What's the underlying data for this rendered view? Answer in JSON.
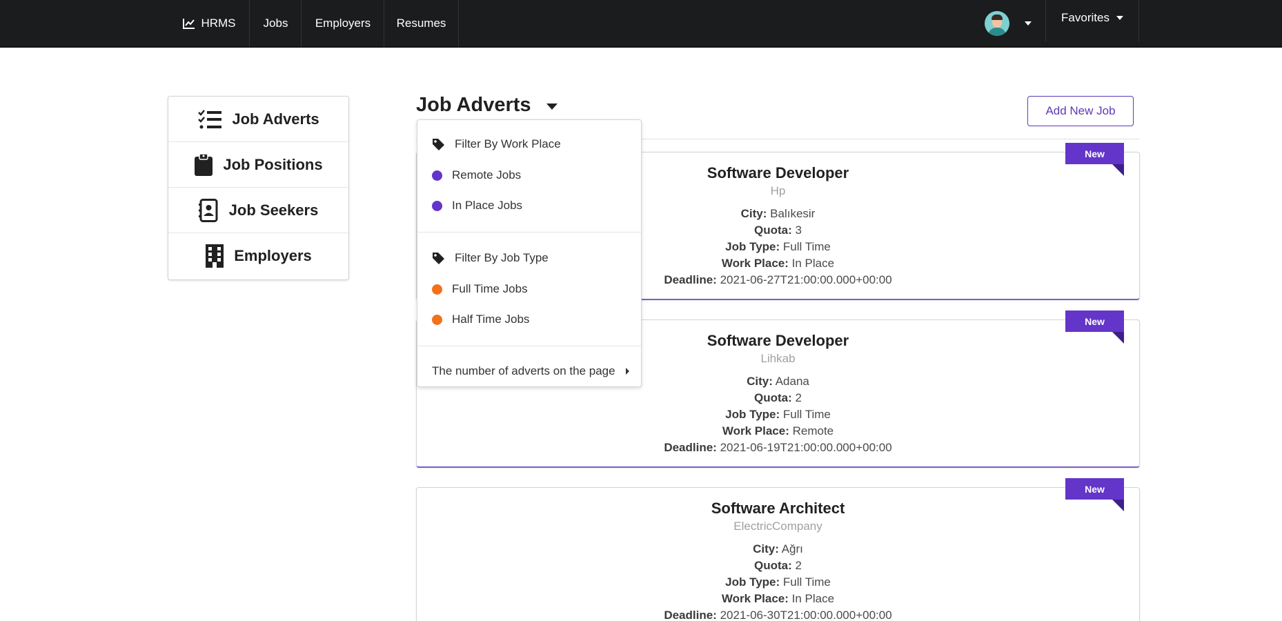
{
  "nav": {
    "brand": "HRMS",
    "items": [
      "Jobs",
      "Employers",
      "Resumes"
    ],
    "favorites": "Favorites"
  },
  "sidebar": {
    "items": [
      {
        "label": "Job Adverts",
        "icon": "tasks-icon"
      },
      {
        "label": "Job Positions",
        "icon": "clipboard-icon"
      },
      {
        "label": "Job Seekers",
        "icon": "address-book-icon"
      },
      {
        "label": "Employers",
        "icon": "building-icon"
      }
    ]
  },
  "header": {
    "title": "Job Adverts",
    "add_button": "Add New Job"
  },
  "dropdown": {
    "work_place_header": "Filter By Work Place",
    "work_place_items": [
      "Remote Jobs",
      "In Place Jobs"
    ],
    "job_type_header": "Filter By Job Type",
    "job_type_items": [
      "Full Time Jobs",
      "Half Time Jobs"
    ],
    "page_count_label": "The number of adverts on the page"
  },
  "labels": {
    "city": "City:",
    "quota": "Quota:",
    "job_type": "Job Type:",
    "work_place": "Work Place:",
    "deadline": "Deadline:",
    "ribbon": "New"
  },
  "colors": {
    "accent": "#6435c9",
    "orange": "#f2711c",
    "topbar": "#1b1c1d"
  },
  "jobs": [
    {
      "title": "Software Developer",
      "company": "Hp",
      "city": "Balıkesir",
      "quota": "3",
      "job_type": "Full Time",
      "work_place": "In Place",
      "deadline": "2021-06-27T21:00:00.000+00:00"
    },
    {
      "title": "Software Developer",
      "company": "Lihkab",
      "city": "Adana",
      "quota": "2",
      "job_type": "Full Time",
      "work_place": "Remote",
      "deadline": "2021-06-19T21:00:00.000+00:00"
    },
    {
      "title": "Software Architect",
      "company": "ElectricCompany",
      "city": "Ağrı",
      "quota": "2",
      "job_type": "Full Time",
      "work_place": "In Place",
      "deadline": "2021-06-30T21:00:00.000+00:00"
    }
  ]
}
